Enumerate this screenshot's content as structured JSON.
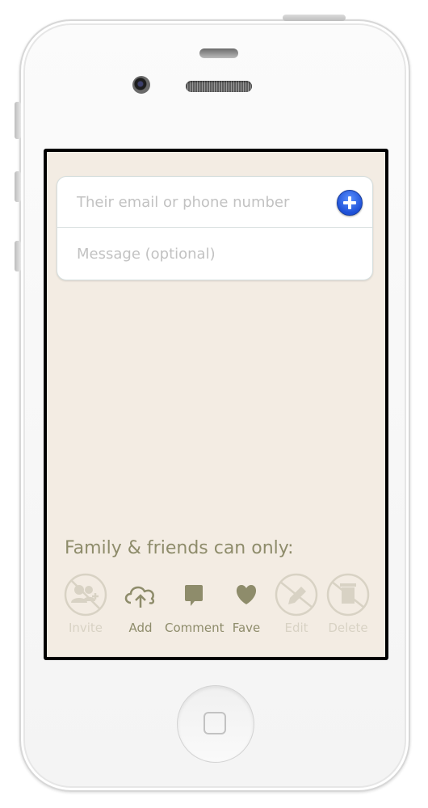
{
  "form": {
    "email_placeholder": "Their email or phone number",
    "message_placeholder": "Message (optional)"
  },
  "permissions": {
    "title": "Family & friends can only:",
    "items": [
      {
        "label": "Invite",
        "icon": "invite-icon",
        "enabled": false
      },
      {
        "label": "Add",
        "icon": "cloud-upload-icon",
        "enabled": true
      },
      {
        "label": "Comment",
        "icon": "comment-icon",
        "enabled": true
      },
      {
        "label": "Fave",
        "icon": "heart-icon",
        "enabled": true
      },
      {
        "label": "Edit",
        "icon": "pencil-icon",
        "enabled": false
      },
      {
        "label": "Delete",
        "icon": "trash-icon",
        "enabled": false
      }
    ]
  },
  "colors": {
    "background": "#f3ece3",
    "accent": "#8e8c6b",
    "disabled": "#d8d2c4",
    "add_button": "#2a62e8"
  }
}
